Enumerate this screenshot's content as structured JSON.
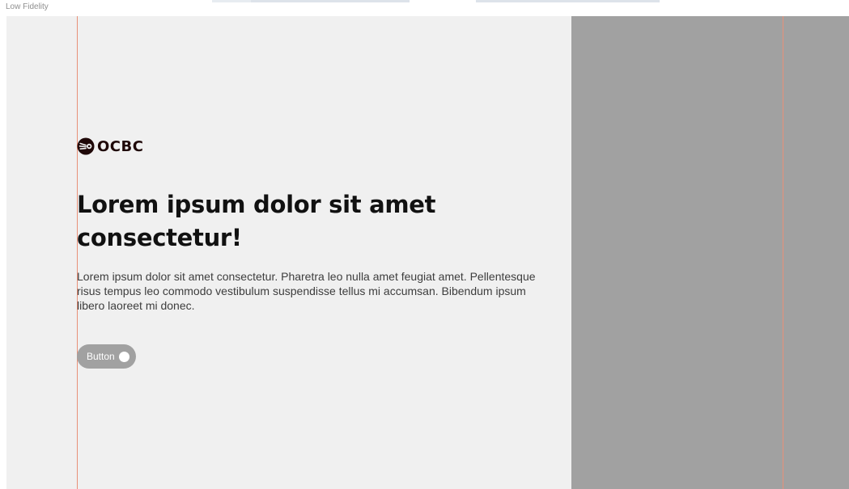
{
  "frame": {
    "label": "Low Fidelity"
  },
  "logo": {
    "icon": "ocbc-logo-mark",
    "text": "OCBC",
    "color": "#1f0808"
  },
  "hero": {
    "headline": "Lorem ipsum dolor sit amet consectetur!",
    "body": "Lorem ipsum dolor sit amet consectetur. Pharetra leo nulla amet feugiat amet. Pellentesque risus tempus leo commodo vestibulum suspendisse tellus mi accumsan. Bibendum ipsum libero laoreet mi donec.",
    "button_label": "Button",
    "button_icon": "circle-icon"
  },
  "colors": {
    "canvas": "#f0f0f0",
    "image_placeholder": "#a1a1a1",
    "guide_line": "#e89078",
    "button": "#a1a1a1"
  }
}
